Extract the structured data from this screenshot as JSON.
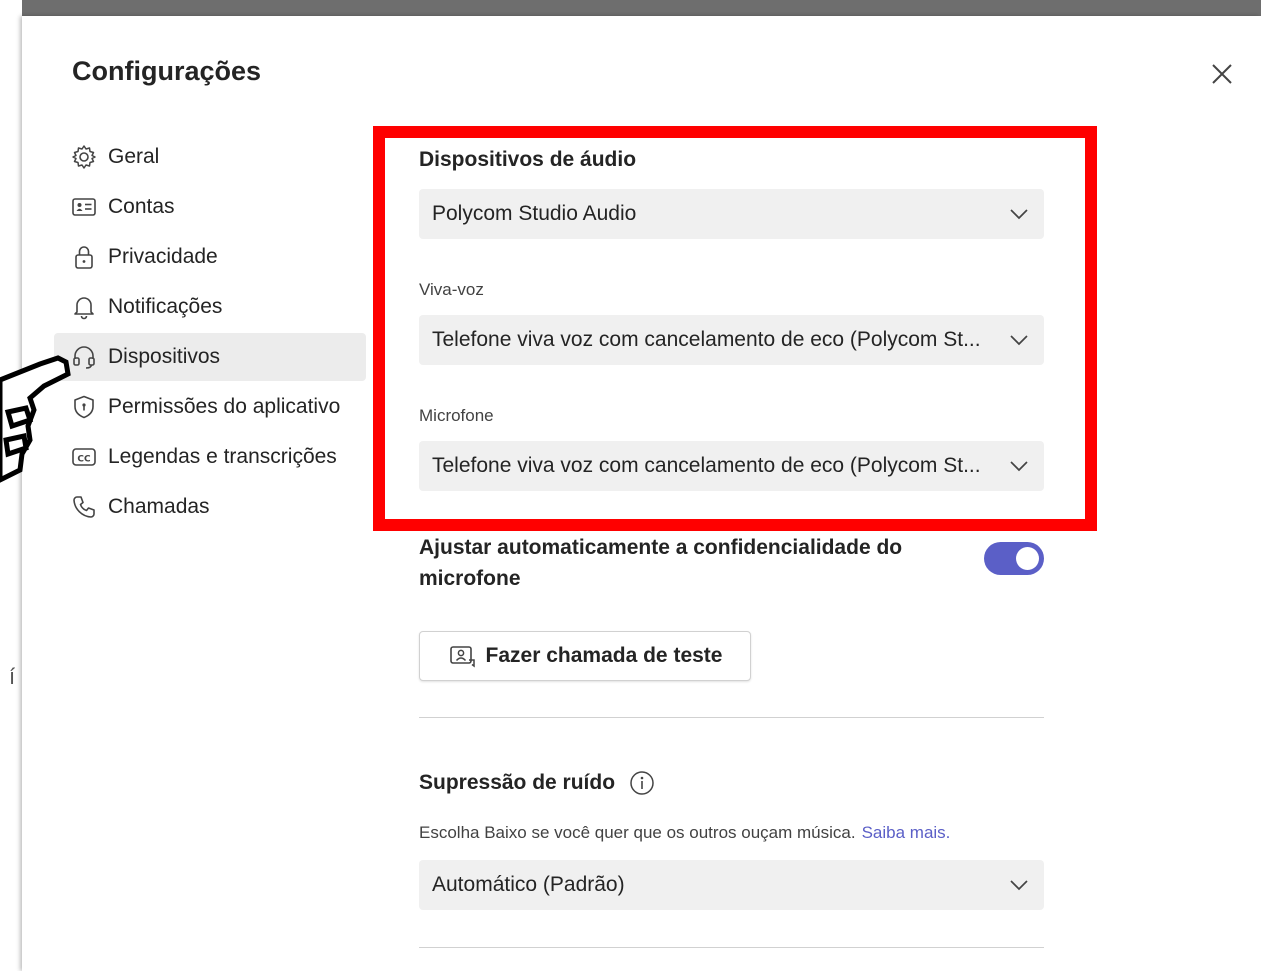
{
  "dialog": {
    "title": "Configurações"
  },
  "nav": {
    "items": [
      {
        "label": "Geral",
        "icon": "gear-icon"
      },
      {
        "label": "Contas",
        "icon": "contact-card-icon"
      },
      {
        "label": "Privacidade",
        "icon": "lock-icon"
      },
      {
        "label": "Notificações",
        "icon": "bell-icon"
      },
      {
        "label": "Dispositivos",
        "icon": "headset-icon",
        "active": true
      },
      {
        "label": "Permissões do aplicativo",
        "icon": "shield-icon"
      },
      {
        "label": "Legendas e transcrições",
        "icon": "closed-caption-icon"
      },
      {
        "label": "Chamadas",
        "icon": "phone-icon"
      }
    ]
  },
  "audio": {
    "title": "Dispositivos de áudio",
    "device_value": "Polycom Studio Audio",
    "speaker_label": "Viva-voz",
    "speaker_value": "Telefone viva voz com cancelamento de eco (Polycom St...",
    "mic_label": "Microfone",
    "mic_value": "Telefone viva voz com cancelamento de eco (Polycom St..."
  },
  "mic_sensitivity": {
    "label": "Ajustar automaticamente a confidencialidade do microfone",
    "enabled": true
  },
  "test_call": {
    "label": "Fazer chamada de teste"
  },
  "noise": {
    "title": "Supressão de ruído",
    "description": "Escolha Baixo se você quer que os outros ouçam música.",
    "link": "Saiba mais.",
    "value": "Automático (Padrão)"
  },
  "colors": {
    "accent": "#5b5fc7",
    "highlight": "#ff0000",
    "dropdown_bg": "#f0f0f0",
    "active_nav_bg": "#ececec"
  }
}
